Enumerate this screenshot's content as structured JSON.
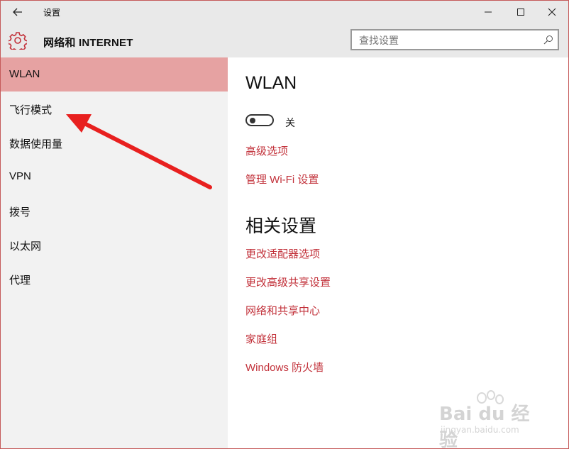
{
  "window": {
    "title": "设置",
    "controls": {
      "minimize": "minimize-icon",
      "maximize": "maximize-icon",
      "close": "close-icon"
    }
  },
  "header": {
    "section_title": "网络和 INTERNET",
    "search_placeholder": "查找设置"
  },
  "sidebar": {
    "items": [
      {
        "label": "WLAN",
        "active": true
      },
      {
        "label": "飞行模式",
        "active": false
      },
      {
        "label": "数据使用量",
        "active": false
      },
      {
        "label": "VPN",
        "active": false
      },
      {
        "label": "拨号",
        "active": false
      },
      {
        "label": "以太网",
        "active": false
      },
      {
        "label": "代理",
        "active": false
      }
    ]
  },
  "main": {
    "heading": "WLAN",
    "toggle": {
      "label": "关",
      "state": "off"
    },
    "links": [
      "高级选项",
      "管理 Wi-Fi 设置"
    ],
    "related": {
      "heading": "相关设置",
      "links": [
        "更改适配器选项",
        "更改高级共享设置",
        "网络和共享中心",
        "家庭组",
        "Windows 防火墙"
      ]
    }
  },
  "watermark": {
    "brand": "Bai du 经验",
    "url": "jingyan.baidu.com"
  },
  "colors": {
    "accent": "#c2313a",
    "active_item": "#e6a2a2",
    "header_bg": "#e9e9e9",
    "sidebar_bg": "#f2f2f2",
    "arrow": "#e8201f"
  }
}
